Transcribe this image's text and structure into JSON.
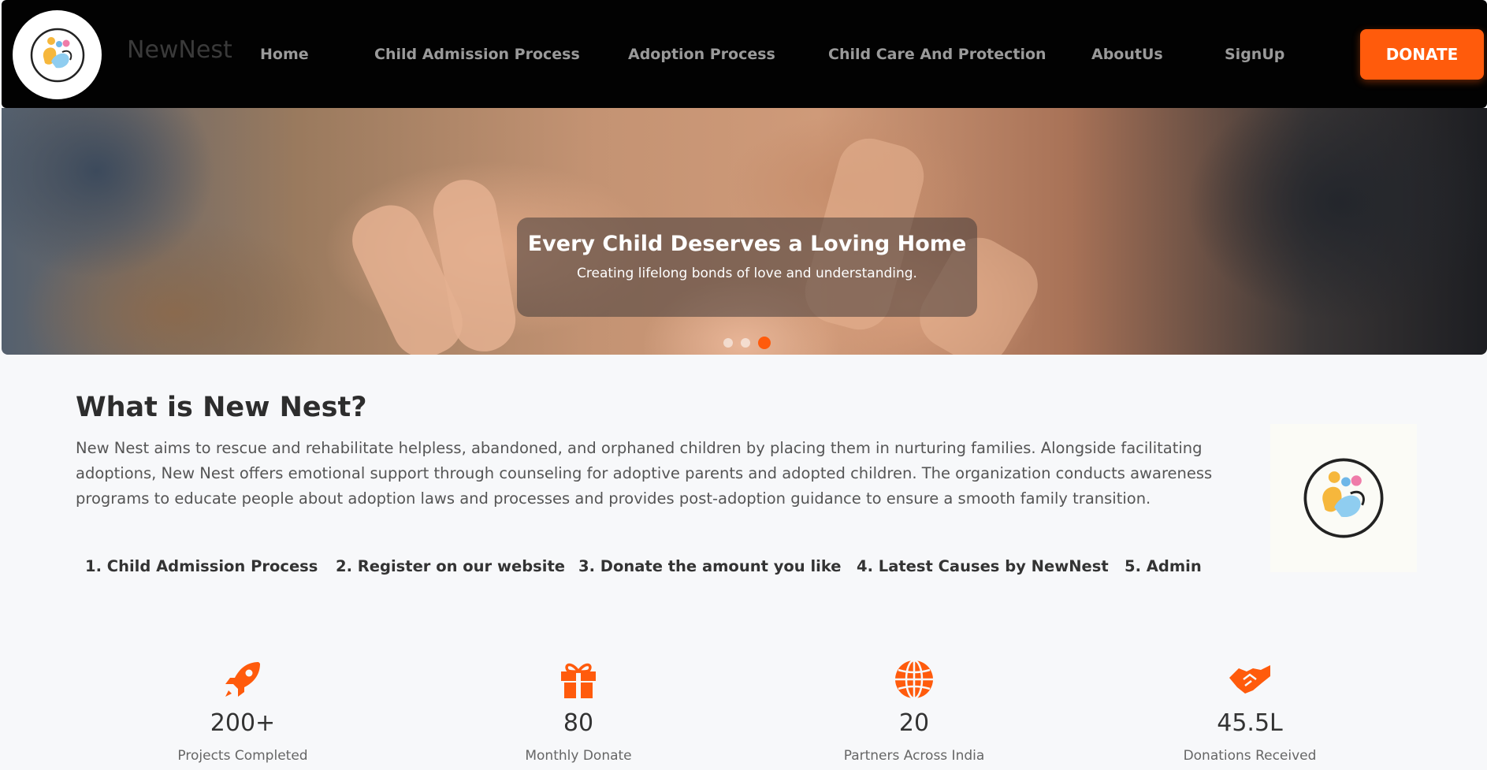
{
  "brand": {
    "name": "NewNest",
    "logo_text": "NEWNEST"
  },
  "nav": {
    "items": [
      {
        "label": "Home"
      },
      {
        "label": "Child Admission Process"
      },
      {
        "label": "Adoption Process"
      },
      {
        "label": "Child Care And Protection"
      },
      {
        "label": "AboutUs"
      },
      {
        "label": "SignUp"
      }
    ],
    "donate_label": "DONATE"
  },
  "hero": {
    "title": "Every Child Deserves a Loving Home",
    "subtitle": "Creating lifelong bonds of love and understanding.",
    "slide_count": 3,
    "active_slide": 3
  },
  "about": {
    "title": "What is New Nest?",
    "text": "New Nest aims to rescue and rehabilitate helpless, abandoned, and orphaned children by placing them in nurturing families. Alongside facilitating adoptions, New Nest offers emotional support through counseling for adoptive parents and adopted children. The organization conducts awareness programs to educate people about adoption laws and processes and provides post-adoption guidance to ensure a smooth family transition.",
    "steps": [
      {
        "label": "1. Child Admission Process"
      },
      {
        "label": "2. Register on our website"
      },
      {
        "label": "3. Donate the amount you like"
      },
      {
        "label": "4. Latest Causes by NewNest"
      },
      {
        "label": "5. Admin"
      }
    ]
  },
  "stats": [
    {
      "icon": "rocket-icon",
      "value": "200+",
      "label": "Projects Completed"
    },
    {
      "icon": "gift-icon",
      "value": "80",
      "label": "Monthly Donate"
    },
    {
      "icon": "globe-icon",
      "value": "20",
      "label": "Partners Across India"
    },
    {
      "icon": "handshake-icon",
      "value": "45.5L",
      "label": "Donations Received"
    }
  ],
  "colors": {
    "accent": "#ff5b0c",
    "header_bg": "#020202",
    "page_bg": "#f7f8fa"
  }
}
